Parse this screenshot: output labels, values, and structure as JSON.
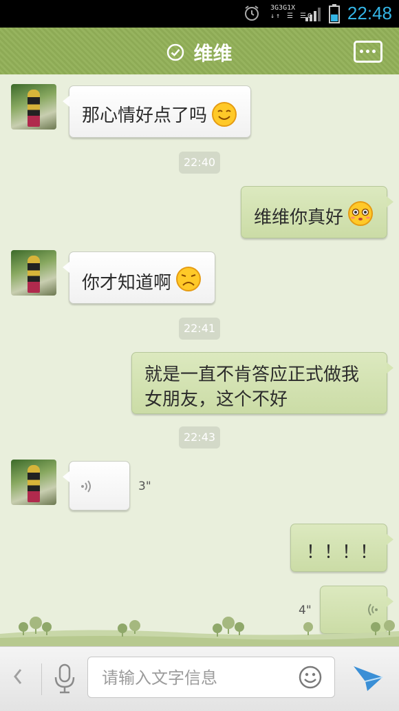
{
  "status_bar": {
    "time": "22:48",
    "network_labels": [
      "3G",
      "3G",
      "1X",
      "G"
    ]
  },
  "header": {
    "title": "维维",
    "menu_icon": "more-dots-icon",
    "verified_icon": "check-circle-icon"
  },
  "messages": [
    {
      "side": "left",
      "type": "text",
      "text": "那心情好点了吗",
      "emoji": "smile-emoji"
    },
    {
      "type": "timestamp",
      "text": "22:40"
    },
    {
      "side": "right",
      "type": "text",
      "text": "维维你真好",
      "emoji": "teary-emoji"
    },
    {
      "side": "left",
      "type": "text",
      "text": "你才知道啊",
      "emoji": "sad-emoji"
    },
    {
      "type": "timestamp",
      "text": "22:41"
    },
    {
      "side": "right",
      "type": "text",
      "lines": [
        "就是一直不肯答应正式做我",
        "女朋友，这个不好"
      ]
    },
    {
      "type": "timestamp",
      "text": "22:43"
    },
    {
      "side": "left",
      "type": "voice",
      "duration": "3\""
    },
    {
      "side": "right",
      "type": "text",
      "text": "！！！！"
    },
    {
      "side": "right",
      "type": "voice",
      "duration": "4\""
    }
  ],
  "input_bar": {
    "placeholder": "请输入文字信息",
    "back_icon": "chevron-left-icon",
    "mic_icon": "microphone-icon",
    "emoji_icon": "smiley-icon",
    "send_icon": "send-icon"
  },
  "colors": {
    "header_green": "#8daa55",
    "chat_bg": "#e9efdc",
    "right_bubble": "#d2e1b0",
    "status_time": "#34b5e5"
  }
}
